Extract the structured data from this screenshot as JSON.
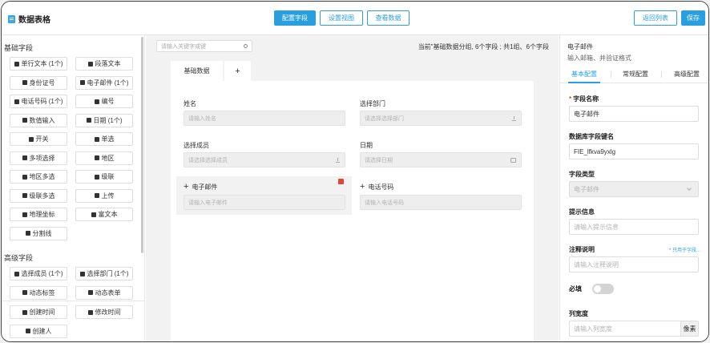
{
  "header": {
    "title": "数据表格",
    "config_fields": "配置字段",
    "set_view": "设置视图",
    "view_data": "查看数据",
    "back_to_list": "返回列表",
    "save": "保存"
  },
  "left": {
    "basic_title": "基础字段",
    "basic_fields": [
      {
        "label": "单行文本 (1个)",
        "icon": "text-line-icon"
      },
      {
        "label": "段落文本",
        "icon": "paragraph-icon"
      },
      {
        "label": "身份证号",
        "icon": "id-card-icon"
      },
      {
        "label": "电子邮件 (1个)",
        "icon": "mail-icon"
      },
      {
        "label": "电话号码 (1个)",
        "icon": "phone-icon"
      },
      {
        "label": "编号",
        "icon": "serial-icon"
      },
      {
        "label": "数值输入",
        "icon": "number-icon"
      },
      {
        "label": "日期 (1个)",
        "icon": "calendar-icon"
      },
      {
        "label": "开关",
        "icon": "toggle-icon"
      },
      {
        "label": "单选",
        "icon": "radio-icon"
      },
      {
        "label": "多项选择",
        "icon": "checkbox-icon"
      },
      {
        "label": "地区",
        "icon": "region-icon"
      },
      {
        "label": "地区多选",
        "icon": "region-multi-icon"
      },
      {
        "label": "级联",
        "icon": "cascade-icon"
      },
      {
        "label": "级联多选",
        "icon": "cascade-multi-icon"
      },
      {
        "label": "上传",
        "icon": "upload-icon"
      },
      {
        "label": "地理坐标",
        "icon": "location-icon"
      },
      {
        "label": "富文本",
        "icon": "rich-text-icon"
      },
      {
        "label": "分割线",
        "icon": "divider-icon"
      }
    ],
    "advanced_title": "高级字段",
    "advanced_fields": [
      {
        "label": "选择成员 (1个)",
        "icon": "member-icon"
      },
      {
        "label": "选择部门 (1个)",
        "icon": "department-icon"
      },
      {
        "label": "动态标签",
        "icon": "tag-icon"
      },
      {
        "label": "动态表单",
        "icon": "form-icon"
      }
    ],
    "system_fields": [
      {
        "label": "创建时间",
        "icon": "clock-icon"
      },
      {
        "label": "修改时间",
        "icon": "clock-edit-icon"
      },
      {
        "label": "创建人",
        "icon": "person-icon"
      }
    ]
  },
  "center": {
    "search_placeholder": "请输入关键字或键",
    "summary": "当前\"基础数据分组, 6个字段 ;    共1组、6个字段",
    "tabs": [
      "基础数据",
      "+"
    ],
    "fields": {
      "name": {
        "label": "姓名",
        "placeholder": "请输入姓名"
      },
      "department": {
        "label": "选择部门",
        "placeholder": "请选择选择部门"
      },
      "member": {
        "label": "选择成员",
        "placeholder": "请选择选择成员"
      },
      "date": {
        "label": "日期",
        "placeholder": "请选择日期"
      },
      "email": {
        "label": "电子邮件",
        "placeholder": "请输入电子邮件"
      },
      "phone": {
        "label": "电话号码",
        "placeholder": "请输入电话号码"
      }
    }
  },
  "right": {
    "title": "电子邮件",
    "subtitle": "输入邮箱、并验证格式",
    "tabs": [
      "基本配置",
      "常规配置",
      "高级配置"
    ],
    "field_name_label": "字段名称",
    "field_name_value": "电子邮件",
    "db_key_label": "数据库字段键名",
    "db_key_value": "FIE_lfkva9yxlg",
    "type_label": "字段类型",
    "type_value": "电子邮件",
    "hint_label": "提示信息",
    "hint_placeholder": "请输入提示信息",
    "note_label": "注释说明",
    "note_link": "* 只用于字段...",
    "note_placeholder": "请输入注释说明",
    "required_label": "必填",
    "width_label": "列宽度",
    "width_placeholder": "请输入列宽度",
    "width_unit": "像素"
  },
  "colors": {
    "accent": "#2a9fe0",
    "danger": "#e0453a"
  }
}
